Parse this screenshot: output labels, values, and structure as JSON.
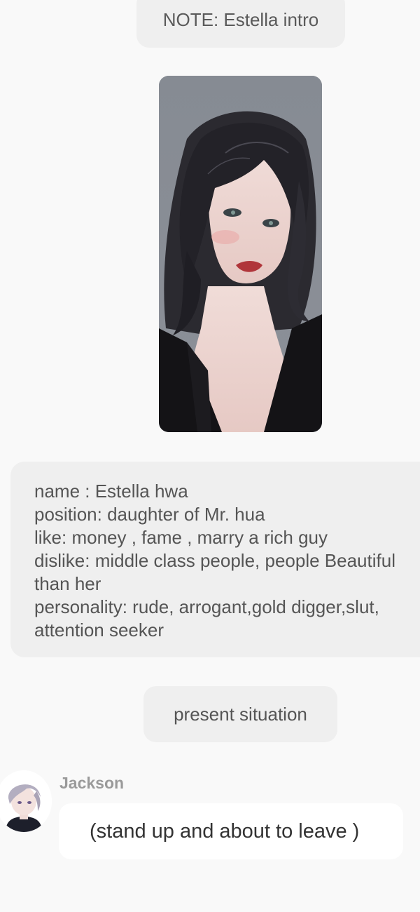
{
  "note": {
    "text": "NOTE: Estella intro"
  },
  "character_image": {
    "icon": "character-portrait"
  },
  "profile": {
    "lines": [
      "name : Estella hwa",
      "position: daughter of Mr. hua",
      "like: money , fame , marry a rich guy",
      "dislike: middle class people, people Beautiful",
      "than her",
      "personality: rude, arrogant,gold digger,slut,",
      "attention seeker"
    ]
  },
  "situation": {
    "text": "present situation"
  },
  "message": {
    "sender": "Jackson",
    "avatar_icon": "user-avatar",
    "text": "(stand up and about to leave )"
  }
}
